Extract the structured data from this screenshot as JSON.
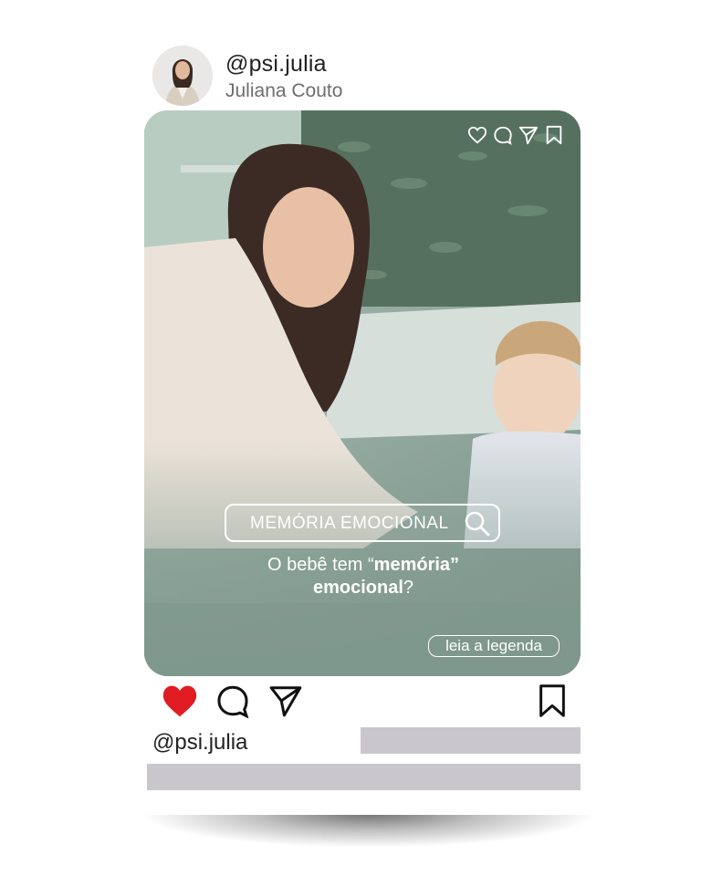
{
  "post": {
    "handle": "@psi.julia",
    "display_name": "Juliana Couto",
    "search_label": "MEMÓRIA EMOCIONAL",
    "question_part1": "O bebê tem “",
    "question_bold1": "memória”",
    "question_bold2": "emocional",
    "question_end": "?",
    "read_caption_button": "leia a legenda",
    "caption_handle": "@psi.julia"
  },
  "colors": {
    "like_red": "#e11b22",
    "overlay_green": "#8ea69c",
    "placeholder_gray": "#c9c7cc"
  },
  "icons": {
    "top": [
      "heart-outline-icon",
      "comment-icon",
      "send-icon",
      "bookmark-icon"
    ],
    "actions": [
      "heart-filled-icon",
      "comment-icon",
      "send-icon",
      "bookmark-icon"
    ]
  }
}
